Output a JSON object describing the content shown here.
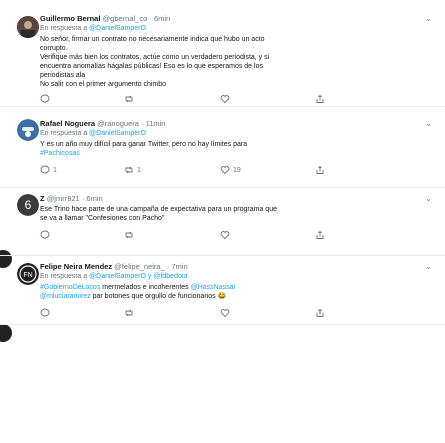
{
  "tweets": [
    {
      "name": "Guillermo Bernal",
      "handle": "@gbernal_co",
      "time": "· 6min",
      "reply_prefix": "En respuesta a",
      "reply_to": "@DanielSamperO",
      "body": [
        "No señor, firmar un contrato no necesariamente indica que hubo un acto",
        "corrupto.",
        "Verifique más bien los contratos, actúe como un verdadero periodista, y si",
        "encuentra anomalías hágalas públicas! Eso es lo que esperamos de los",
        "periodistas ala",
        "No salir con el primer argumento chimbo"
      ],
      "replies": "",
      "retweets": "",
      "likes": ""
    },
    {
      "name": "Rafael Noguera",
      "handle": "@ranoguera",
      "time": "· 11min",
      "reply_prefix": "En respuesta a",
      "reply_to": "@DanielSamperO",
      "body": [
        "Y es un año muy difícil para ganar Twitter, pero no hay límites para"
      ],
      "hashtag": "#Pachicosas",
      "replies": "1",
      "retweets": "1",
      "likes": "19"
    },
    {
      "name": "Z",
      "handle": "@jmrr821",
      "time": "· 6min",
      "body": [
        "Ese Trino hace parte de una campaña de expectativa para un programa que",
        "se va a llamar \"Confesiones con Pacho\""
      ],
      "replies": "",
      "retweets": "",
      "likes": ""
    },
    {
      "name": "Felipe Neira Mendez",
      "handle": "@felipe_neira_",
      "time": "· 7min",
      "reply_prefix": "En respuesta a",
      "reply_to": "@DanielSamperO y @fdbedout",
      "hashtags_line": "#GobiernoDeLocos",
      "line1_rest": " mermelados e incoherentes ",
      "mention1": "@HassNassar",
      "mention2": "@mluciaramirez",
      "line2_rest": " par botones que orgullo de funcionarios 😂",
      "replies": "",
      "retweets": "",
      "likes": ""
    }
  ],
  "icons": {
    "reply": "reply-icon",
    "retweet": "retweet-icon",
    "like": "heart-icon",
    "share": "share-icon",
    "menu": "chevron-down-icon"
  },
  "colors": {
    "accent": "#1da1f2",
    "muted": "#657786",
    "text": "#14171a"
  }
}
